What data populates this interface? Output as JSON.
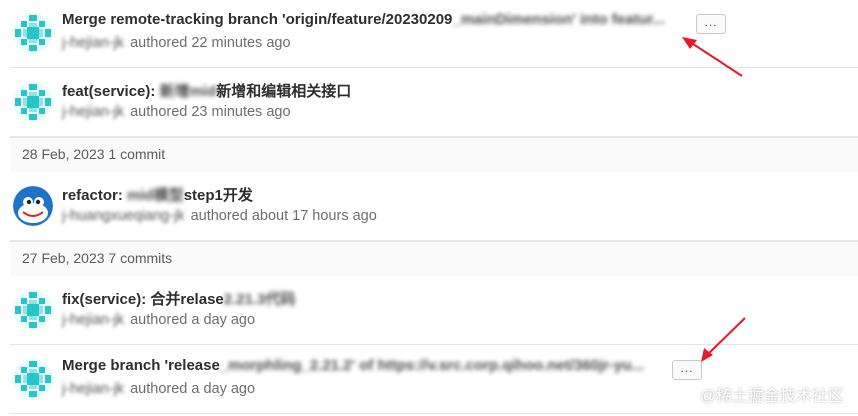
{
  "commits": [
    {
      "title_visible": "Merge remote-tracking branch 'origin/feature/20230209",
      "title_blurred": "_mainDimension' into featur...",
      "author": "j-hejian-jk",
      "time_text": "authored 22 minutes ago",
      "has_more": true,
      "avatar": "teal-mosaic"
    },
    {
      "title_visible": "feat(service):",
      "title_blurred": "新增mid",
      "title_tail": "新增和编辑相关接口",
      "author": "j-hejian-jk",
      "time_text": "authored 23 minutes ago",
      "has_more": false,
      "avatar": "teal-mosaic"
    },
    {
      "title_visible": "refactor:",
      "title_blurred": "mid模型",
      "title_tail": "step1开发",
      "author": "j-huangxueqiang-jk",
      "time_text": "authored about 17 hours ago",
      "has_more": false,
      "avatar": "dolphin"
    },
    {
      "title_visible": "fix(service): 合并relase",
      "title_blurred": "2.21.3代码",
      "author": "j-hejian-jk",
      "time_text": "authored a day ago",
      "has_more": false,
      "avatar": "teal-mosaic"
    },
    {
      "title_visible": "Merge branch 'release",
      "title_blurred": "_morphling_2.21.2' of https://v.src.corp.qihoo.net/360jr-yu...",
      "author": "j-hejian-jk",
      "time_text": "authored a day ago",
      "has_more": true,
      "avatar": "teal-mosaic"
    }
  ],
  "day_headers": [
    {
      "label": "28 Feb, 2023 1 commit"
    },
    {
      "label": "27 Feb, 2023 7 commits"
    }
  ],
  "more_label": "...",
  "watermark": "@稀土掘金技术社区",
  "colors": {
    "annotation_arrow": "#e8192c",
    "avatar_teal": "#27c4c9",
    "avatar_blue": "#1e73c8"
  }
}
